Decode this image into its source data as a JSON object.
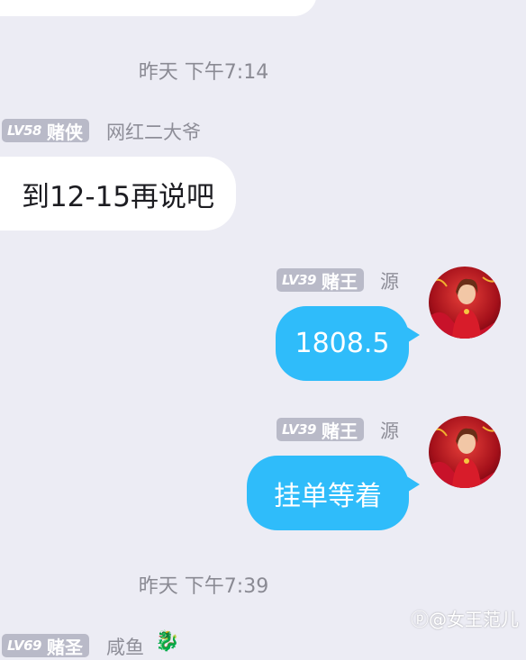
{
  "timestamps": [
    "昨天 下午7:14",
    "昨天 下午7:39"
  ],
  "messages": [
    {
      "side": "left",
      "level": "LV58",
      "title": "赌侠",
      "nickname": "网红二大爷",
      "text": "到12-15再说吧"
    },
    {
      "side": "right",
      "level": "LV39",
      "title": "赌王",
      "nickname": "源",
      "text": "1808.5"
    },
    {
      "side": "right",
      "level": "LV39",
      "title": "赌王",
      "nickname": "源",
      "text": "挂单等着"
    },
    {
      "side": "left",
      "level": "LV69",
      "title": "赌圣",
      "nickname": "咸鱼"
    }
  ],
  "watermark": "@女王范儿",
  "colors": {
    "background": "#ececf4",
    "bubble_blue": "#2fbcfa",
    "badge": "#b9bac8"
  }
}
